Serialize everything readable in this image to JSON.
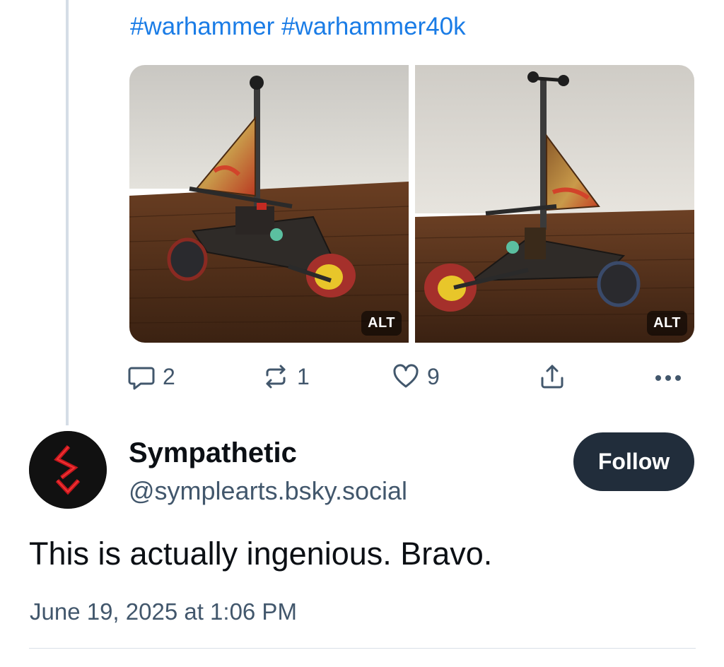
{
  "post": {
    "hashtags": [
      "#warhammer",
      "#warhammer40k"
    ],
    "images": [
      {
        "alt_label": "ALT"
      },
      {
        "alt_label": "ALT"
      }
    ],
    "actions": {
      "reply_count": "2",
      "repost_count": "1",
      "like_count": "9",
      "reply_icon": "speech-bubble-icon",
      "repost_icon": "repost-arrows-icon",
      "like_icon": "heart-outline-icon",
      "share_icon": "share-upload-icon",
      "more_icon": "ellipsis-icon"
    }
  },
  "reply": {
    "display_name": "Sympathetic",
    "handle": "@symplearts.bsky.social",
    "follow_label": "Follow",
    "text": "This is actually ingenious. Bravo.",
    "timestamp": "June 19, 2025 at 1:06 PM"
  },
  "colors": {
    "link": "#1a7ce6",
    "muted": "#42576c",
    "follow_bg": "#212d3b",
    "thread_line": "#d5dde6",
    "avatar_accent": "#c4161c"
  }
}
